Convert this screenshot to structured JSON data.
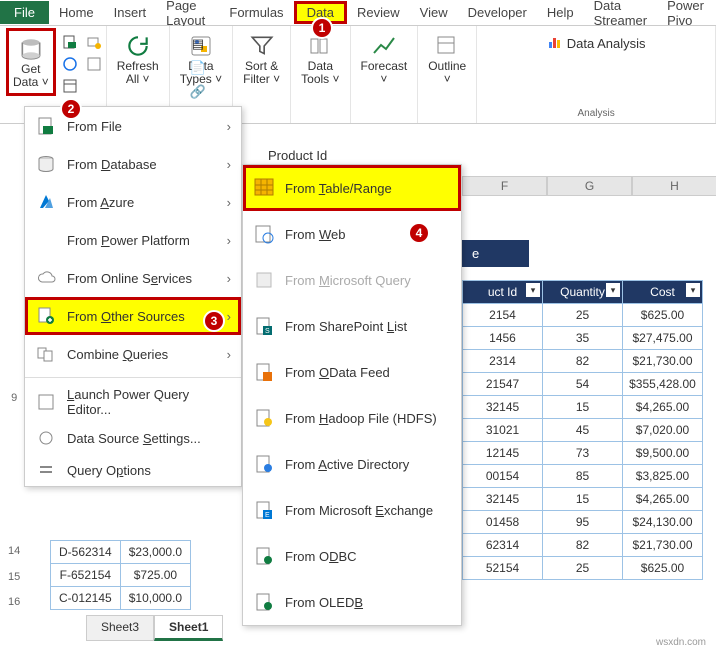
{
  "tabs": {
    "file": "File",
    "home": "Home",
    "insert": "Insert",
    "page_layout": "Page Layout",
    "formulas": "Formulas",
    "data": "Data",
    "review": "Review",
    "view": "View",
    "developer": "Developer",
    "help": "Help",
    "data_streamer": "Data Streamer",
    "power_piv": "Power Pivo"
  },
  "ribbon": {
    "get_data": "Get",
    "get_data2": "Data",
    "refresh_all": "Refresh",
    "refresh_all2": "All",
    "data_types": "Data",
    "data_types2": "Types",
    "sort_filter": "Sort &",
    "sort_filter2": "Filter",
    "data_tools": "Data",
    "data_tools2": "Tools",
    "forecast": "Forecast",
    "outline": "Outline",
    "data_analysis": "Data Analysis",
    "group_data_types": "Data Types",
    "group_analysis": "Analysis"
  },
  "menu1": {
    "from_file": "From File",
    "from_database": "From Database",
    "from_azure": "From Azure",
    "from_power_platform": "From Power Platform",
    "from_online_services": "From Online Services",
    "from_other_sources": "From Other Sources",
    "combine_queries": "Combine Queries",
    "launch_pqe": "Launch Power Query Editor...",
    "data_source_settings": "Data Source Settings...",
    "query_options": "Query Options"
  },
  "menu2": {
    "from_table_range": "From Table/Range",
    "from_web": "From Web",
    "from_ms_query": "From Microsoft Query",
    "from_sharepoint": "From SharePoint List",
    "from_odata": "From OData Feed",
    "from_hadoop": "From Hadoop File (HDFS)",
    "from_ad": "From Active Directory",
    "from_exchange": "From Microsoft Exchange",
    "from_odbc": "From ODBC",
    "from_oledb": "From OLEDB"
  },
  "formula_bar": "Product Id",
  "col_headers": [
    "F",
    "G",
    "H"
  ],
  "title_frag": "e",
  "table": {
    "headers": [
      "uct Id",
      "Quantity",
      "Cost"
    ],
    "rows": [
      [
        "2154",
        "25",
        "$625.00"
      ],
      [
        "1456",
        "35",
        "$27,475.00"
      ],
      [
        "2314",
        "82",
        "$21,730.00"
      ],
      [
        "21547",
        "54",
        "$355,428.00"
      ],
      [
        "32145",
        "15",
        "$4,265.00"
      ],
      [
        "31021",
        "45",
        "$7,020.00"
      ],
      [
        "12145",
        "73",
        "$9,500.00"
      ],
      [
        "00154",
        "85",
        "$3,825.00"
      ],
      [
        "32145",
        "15",
        "$4,265.00"
      ],
      [
        "01458",
        "95",
        "$24,130.00"
      ],
      [
        "62314",
        "82",
        "$21,730.00"
      ],
      [
        "52154",
        "25",
        "$625.00"
      ]
    ]
  },
  "left_table": {
    "rows": [
      [
        "D-562314",
        "$23,000.0"
      ],
      [
        "F-652154",
        "$725.00"
      ],
      [
        "C-012145",
        "$10,000.0"
      ]
    ]
  },
  "row_labels": [
    "9",
    "",
    "",
    "",
    "",
    "",
    "14",
    "15",
    "16"
  ],
  "sheets": {
    "s3": "Sheet3",
    "s1": "Sheet1"
  },
  "markers": {
    "m1": "1",
    "m2": "2",
    "m3": "3",
    "m4": "4"
  },
  "watermark": "wsxdn.com"
}
